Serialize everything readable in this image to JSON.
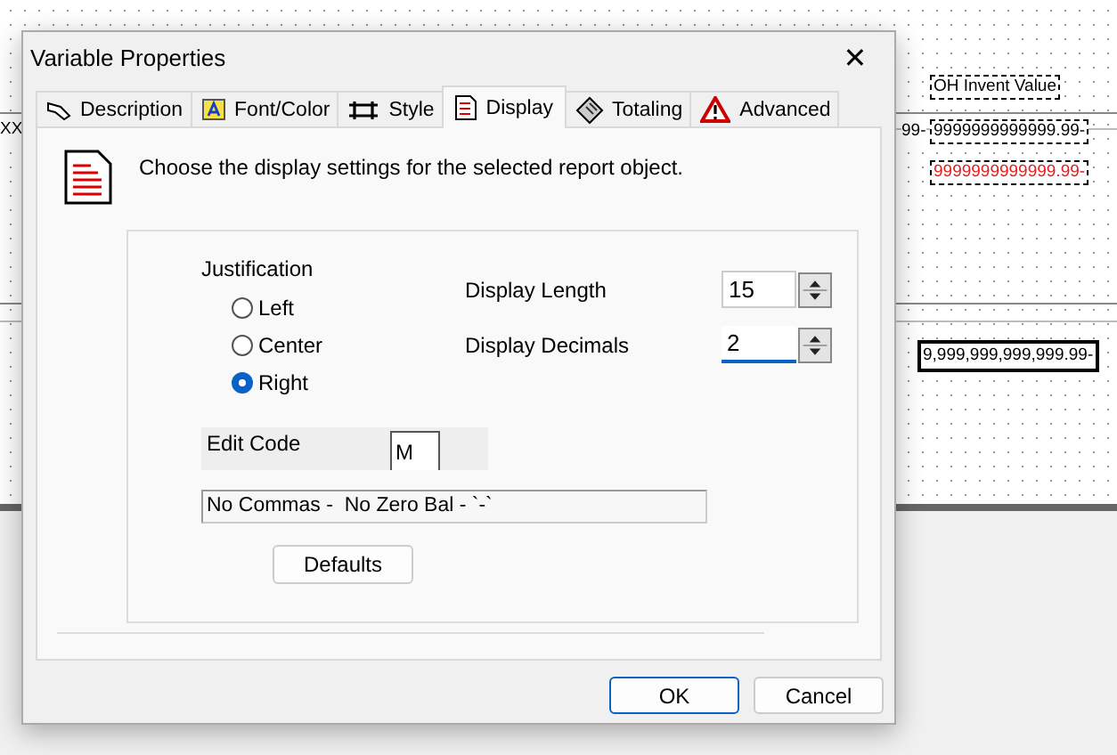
{
  "canvas": {
    "left_cut": "XX",
    "header": "OH Invent Value",
    "value_black": "9999999999999.99-",
    "value_red": "9999999999999.99-",
    "value_cut": "99-",
    "formatted": "9,999,999,999,999.99-"
  },
  "window": {
    "title": "Variable Properties",
    "close": "✕"
  },
  "tabs": [
    {
      "label": "Description",
      "selected": false
    },
    {
      "label": "Font/Color",
      "selected": false
    },
    {
      "label": "Style",
      "selected": false
    },
    {
      "label": "Display",
      "selected": true
    },
    {
      "label": "Totaling",
      "selected": false
    },
    {
      "label": "Advanced",
      "selected": false
    }
  ],
  "instructions": "Choose the display settings for the selected report object.",
  "justification": {
    "label": "Justification",
    "options": [
      {
        "label": "Left",
        "selected": false
      },
      {
        "label": "Center",
        "selected": false
      },
      {
        "label": "Right",
        "selected": true
      }
    ]
  },
  "fields": [
    {
      "label": "Display Length",
      "value": "15",
      "focused": false
    },
    {
      "label": "Display Decimals",
      "value": "2",
      "focused": true
    }
  ],
  "edit_code": {
    "label": "Edit Code",
    "value": "M",
    "description": "No Commas -  No Zero Bal - `-`"
  },
  "defaults_button": "Defaults",
  "buttons": [
    {
      "label": "OK",
      "default": true
    },
    {
      "label": "Cancel",
      "default": false
    }
  ]
}
